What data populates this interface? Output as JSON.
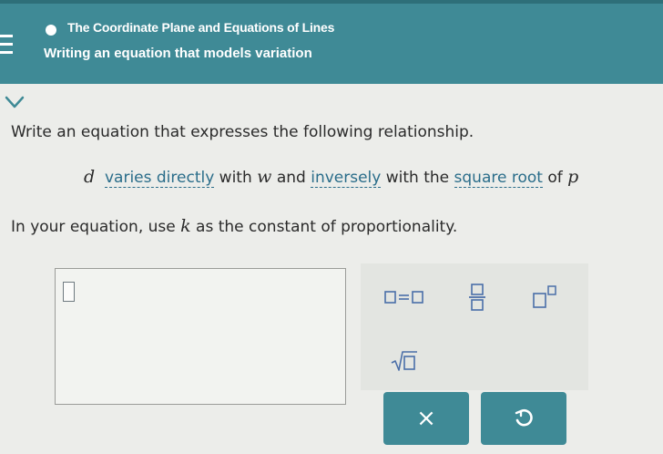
{
  "header": {
    "topic": "The Coordinate Plane and Equations of Lines",
    "subtopic": "Writing an equation that models variation"
  },
  "question": {
    "prompt": "Write an equation that expresses the following relationship.",
    "relation": {
      "var_d": "d",
      "term_varies_directly": "varies directly",
      "with_1": " with ",
      "var_w": "w",
      "and_text": " and ",
      "term_inversely": "inversely",
      "with_2": " with the ",
      "term_square_root": "square root",
      "of_text": " of ",
      "var_p": "p"
    },
    "instruction": {
      "before": "In your equation, use ",
      "var_k": "k",
      "after": " as the constant of proportionality."
    }
  },
  "answer": {
    "value": ""
  },
  "palette": {
    "keys": [
      "equals-template",
      "fraction-template",
      "exponent-template",
      "square-root-template"
    ]
  },
  "actions": {
    "clear": "×",
    "undo": "undo"
  },
  "colors": {
    "header": "#3f8a96",
    "term_link": "#2a6d8a",
    "palette_key": "#4a6ea8",
    "background": "#ecedea"
  }
}
